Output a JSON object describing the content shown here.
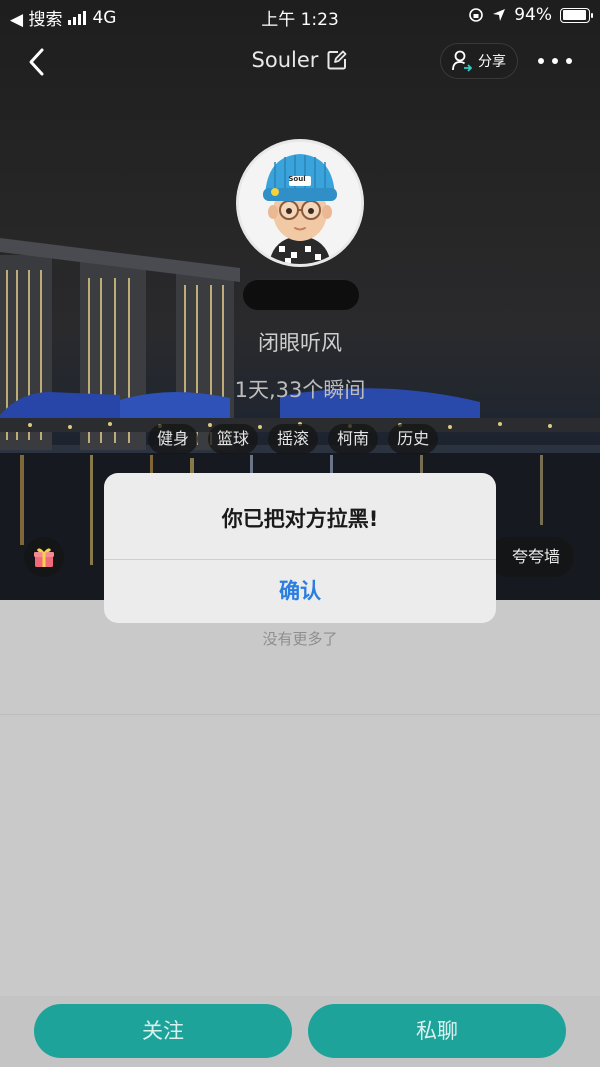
{
  "status_bar": {
    "back_app": "◀ 搜索",
    "network": "4G",
    "time": "上午 1:23",
    "battery": "94%",
    "battery_level": 0.94
  },
  "nav": {
    "title": "Souler",
    "share_label": "分享"
  },
  "profile": {
    "hat_text": "Soul",
    "signature": "闭眼听风",
    "stats": "1天,33个瞬间",
    "tags": [
      "健身",
      "篮球",
      "摇滚",
      "柯南",
      "历史"
    ],
    "wall_label": "夸夸墙"
  },
  "feed": {
    "no_more": "没有更多了"
  },
  "dialog": {
    "message": "你已把对方拉黑!",
    "confirm_label": "确认"
  },
  "actions": {
    "follow_label": "关注",
    "chat_label": "私聊"
  },
  "colors": {
    "primary": "#1ea39a",
    "dialog_button": "#2b7de0"
  }
}
